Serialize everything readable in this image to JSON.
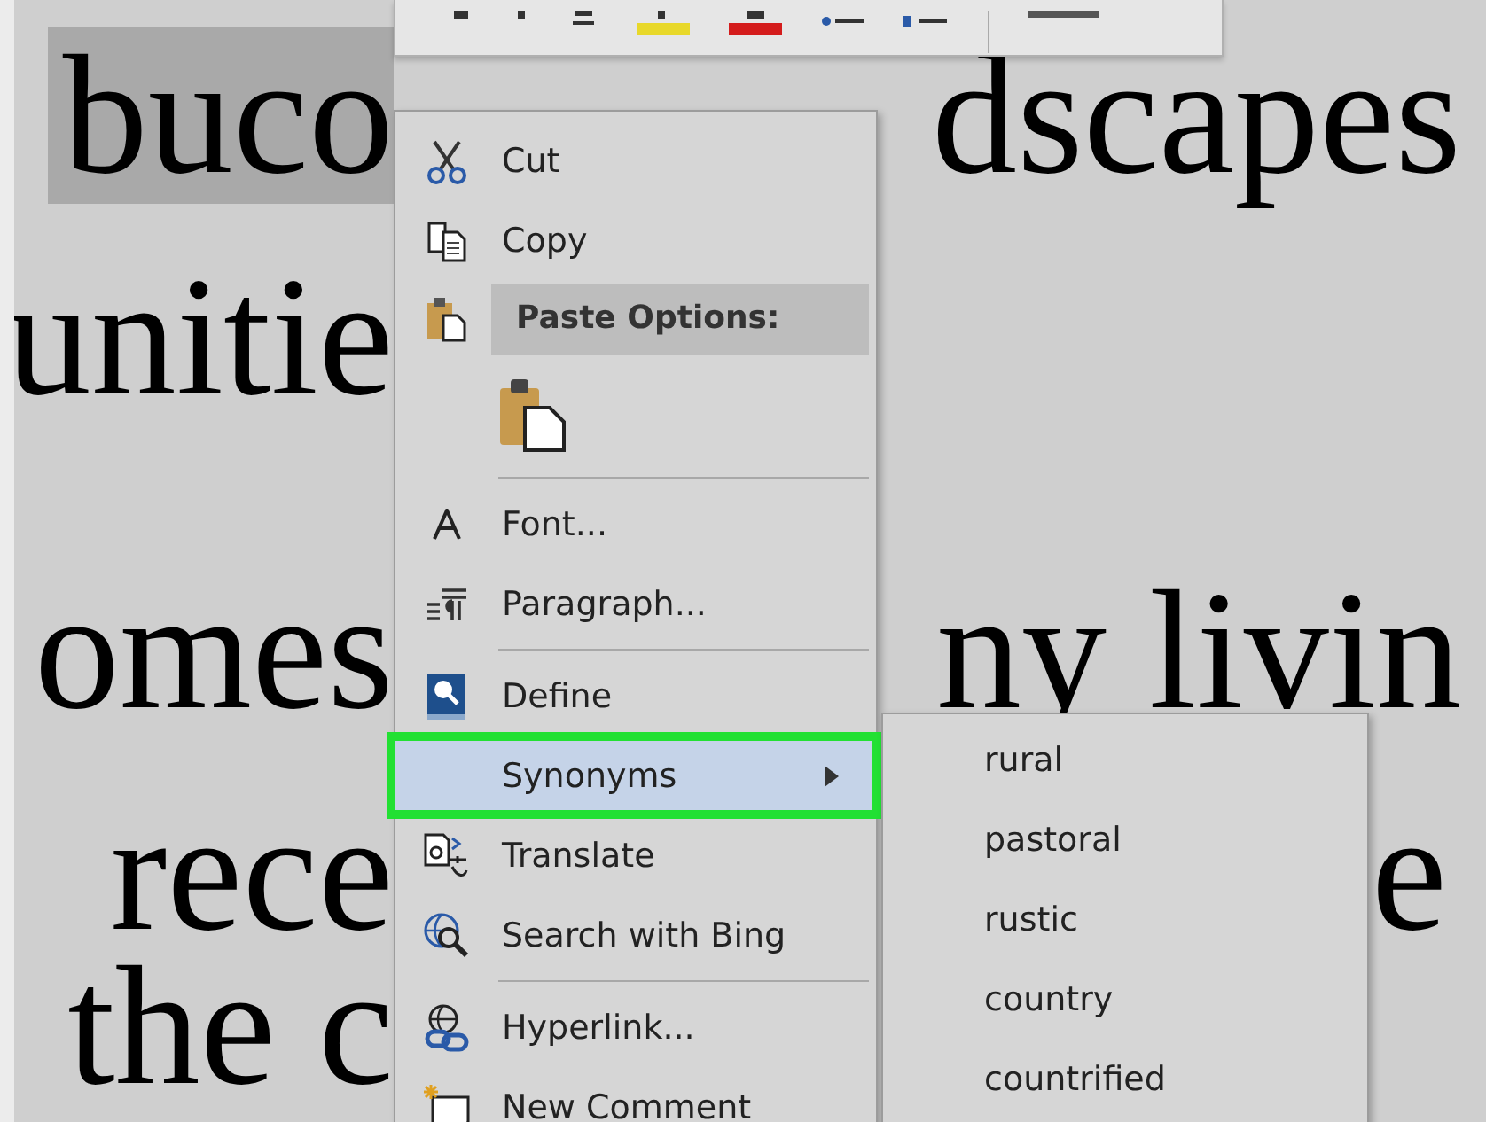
{
  "document": {
    "lines": [
      {
        "left": {
          "text": "buco",
          "selected": true
        },
        "right": "dscapes"
      },
      {
        "left": {
          "text": "unitie",
          "selected": false
        }
      },
      {
        "left": {
          "text": "omes",
          "selected": false
        },
        "right": "ny livin"
      },
      {
        "left": {
          "text": "rece",
          "selected": false
        },
        "right": "e"
      },
      {
        "left": {
          "text": "the c",
          "selected": false
        }
      }
    ]
  },
  "context_menu": {
    "items": [
      {
        "kind": "item",
        "label": "Cut",
        "selected": false
      },
      {
        "kind": "item",
        "label": "Copy",
        "selected": false
      },
      {
        "kind": "header",
        "label": "Paste Options:"
      },
      {
        "kind": "paste"
      },
      {
        "kind": "separator"
      },
      {
        "kind": "item",
        "label": "Font...",
        "selected": false
      },
      {
        "kind": "item",
        "label": "Paragraph...",
        "selected": false
      },
      {
        "kind": "separator"
      },
      {
        "kind": "item",
        "label": "Define",
        "selected": false
      },
      {
        "kind": "item",
        "label": "Synonyms",
        "selected": true,
        "submenu": true
      },
      {
        "kind": "item",
        "label": "Translate",
        "selected": false
      },
      {
        "kind": "item",
        "label": "Search with Bing",
        "selected": false
      },
      {
        "kind": "separator"
      },
      {
        "kind": "item",
        "label": "Hyperlink...",
        "selected": false
      },
      {
        "kind": "item",
        "label": "New Comment",
        "selected": false
      }
    ]
  },
  "synonyms_menu": {
    "items": [
      "rural",
      "pastoral",
      "rustic",
      "country",
      "countrified"
    ]
  }
}
